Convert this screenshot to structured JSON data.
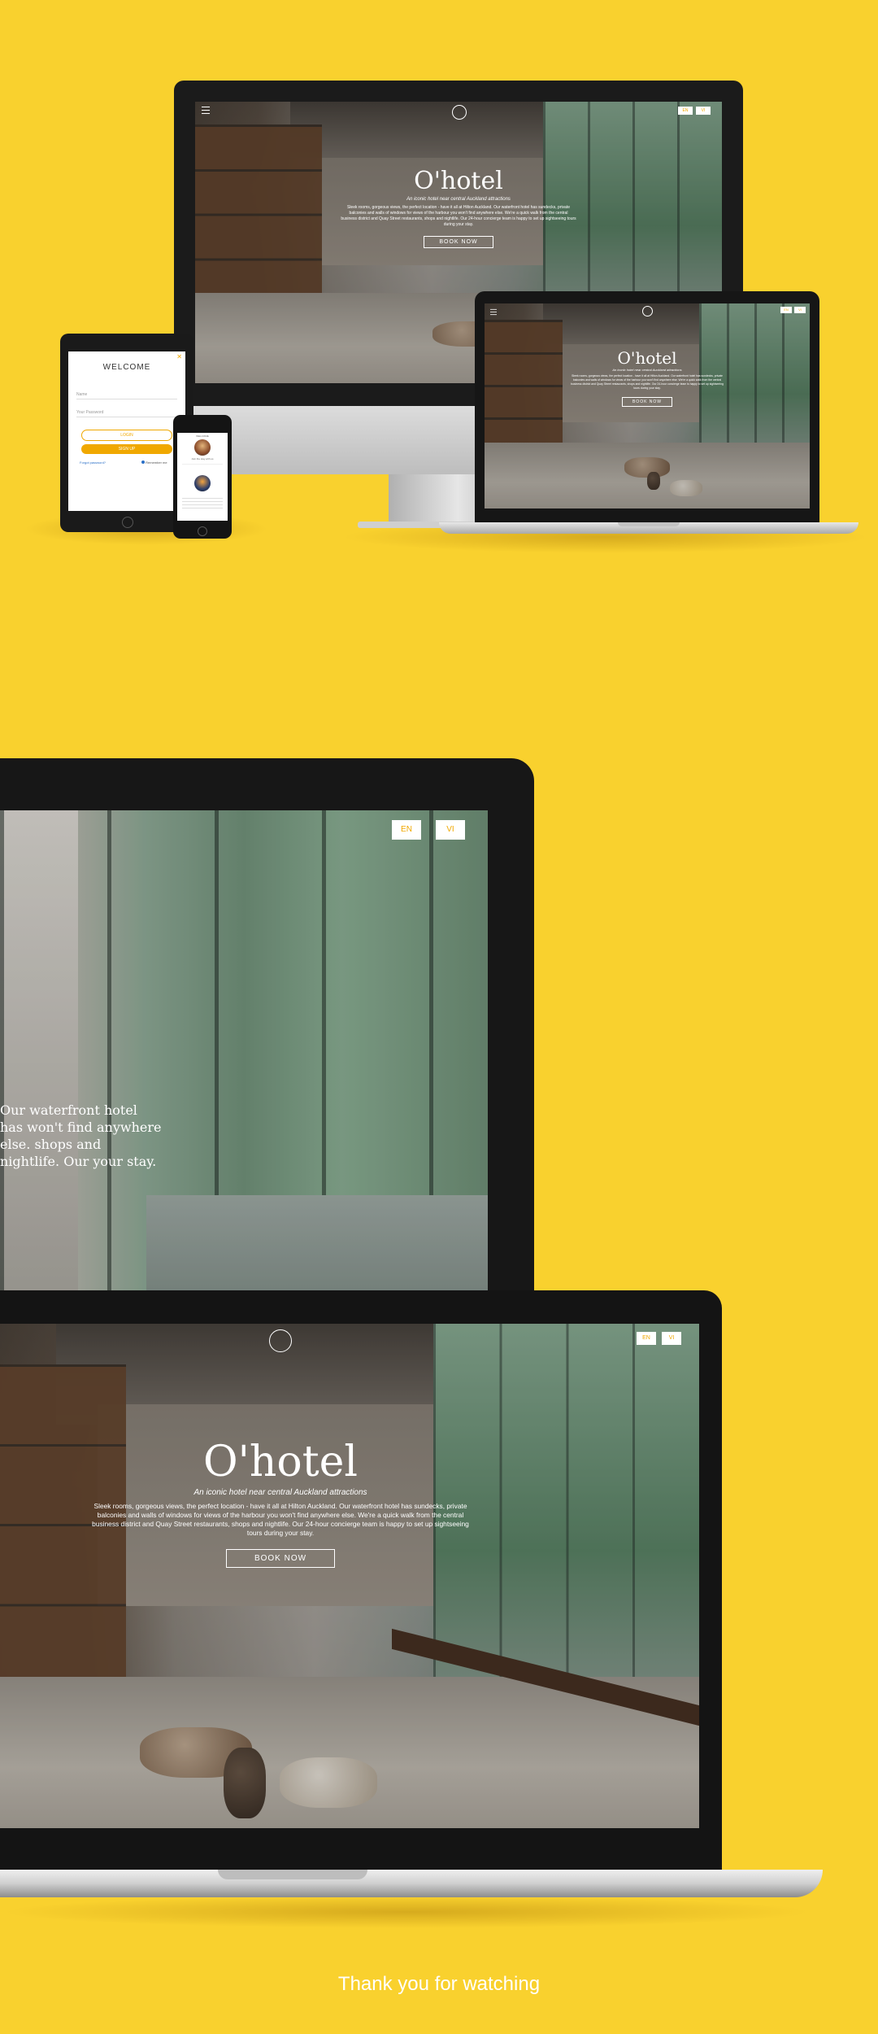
{
  "hotel": {
    "brand": "O'hotel",
    "tagline": "An iconic hotel near central Auckland attractions",
    "intro": "Sleek rooms, gorgeous views, the perfect location - have it all at Hilton Auckland. Our waterfront hotel has sundecks, private balconies and walls of windows for views of the harbour you won't find anywhere else. We're a quick walk from the central business district and Quay Street restaurants, shops and nightlife. Our 24-hour concierge team is happy to set up sightseeing tours during your stay.",
    "intro_fragment": "Our waterfront hotel has won't find anywhere else. shops and nightlife. Our your stay.",
    "book_label": "BOOK NOW",
    "lang_en": "EN",
    "lang_vi": "VI"
  },
  "tablet": {
    "title": "WELCOME",
    "username_placeholder": "Name",
    "password_placeholder": "Your Password",
    "login_label": "LOGIN",
    "signup_label": "SIGN UP",
    "forgot_label": "Forgot password?",
    "remember_label": "Remember me"
  },
  "phone": {
    "header": "WELCOME",
    "profile_label": "Join the stay with us"
  },
  "footer": {
    "thanks": "Thank you for watching"
  }
}
